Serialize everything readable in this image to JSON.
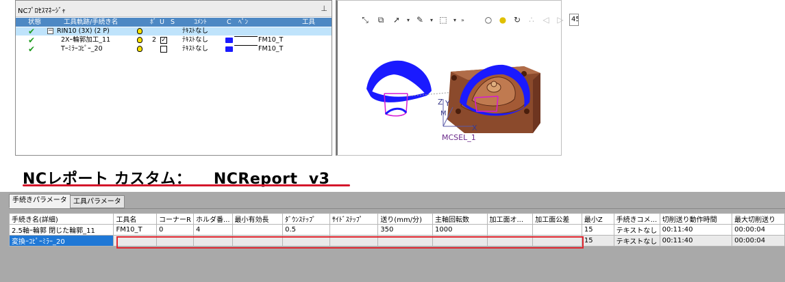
{
  "nc_process_manager": {
    "title": "NCﾌﾟﾛｾｽﾏﾈｰｼﾞｬ",
    "columns": [
      "状態",
      "工具軌跡/手続き名",
      "ﾎﾞ",
      "U",
      "S",
      "ｺﾒﾝﾄ",
      "C",
      "ﾍﾟﾝ",
      "工具"
    ],
    "rows": [
      {
        "name": "RIN10 (3X) (2 P)",
        "count": "",
        "checked": false,
        "has_checkbox": false,
        "comment": "ﾃｷｽﾄなし",
        "pen": false,
        "tool": ""
      },
      {
        "name": "2Xｰ輪郭加工_11",
        "count": "2",
        "checked": true,
        "has_checkbox": true,
        "comment": "ﾃｷｽﾄなし",
        "pen": true,
        "tool": "FM10_T"
      },
      {
        "name": "Tｰﾐﾗｰｺﾋﾟｰ_20",
        "count": "",
        "checked": false,
        "has_checkbox": true,
        "comment": "ﾃｷｽﾄなし",
        "pen": true,
        "tool": "FM10_T"
      }
    ],
    "tree_toggle": "−"
  },
  "view3d": {
    "zoom_value": "45",
    "axis_labels": {
      "z": "Z",
      "y": "Y",
      "x": "X",
      "m": "M"
    },
    "csys_label": "MCSEL_1",
    "toolbar_icons": [
      "select-x-icon",
      "box-select-icon",
      "cursor-icon",
      "pen-icon",
      "dotted-select-icon",
      "more-icon"
    ],
    "right_icons": [
      "bulb-outline-icon",
      "bulb-yellow-icon",
      "bulb-refresh-icon",
      "bulb-group-icon",
      "arrow-left-icon",
      "arrow-right-icon"
    ]
  },
  "heading": "NCレポート カスタム：    NCReport  v3",
  "colors": {
    "accent_red": "#d4142a",
    "selection_blue": "#1f78d6",
    "header_blue": "#4d88c4",
    "toolpath_blue": "#1a1aff",
    "magenta": "#d51ad5",
    "block_brown": "#8b4a2c"
  },
  "report": {
    "tabs": [
      "手続きパラメータ",
      "工具パラメータ"
    ],
    "columns": [
      "手続き名(詳細)",
      "工具名",
      "コーナーR",
      "ホルダ番...",
      "最小有効長",
      "ﾀﾞｳﾝｽﾃｯﾌﾟ",
      "ｻｲﾄﾞｽﾃｯﾌﾟ",
      "送り(mm/分)",
      "主軸回転数",
      "加工面オ...",
      "加工面公差",
      "最小Z",
      "手続きコメ...",
      "切削送り動作時間",
      "最大切削送り"
    ],
    "rows": [
      [
        "2.5軸ｰ輪郭 閉じた輪郭_11",
        "FM10_T",
        "0",
        "4",
        "",
        "0.5",
        "",
        "350",
        "1000",
        "",
        "",
        "15",
        "テキストなし",
        "00:11:40",
        "00:00:04"
      ],
      [
        "変換ｰｺﾋﾟｰﾐﾗｰ_20",
        "",
        "",
        "",
        "",
        "",
        "",
        "",
        "",
        "",
        "",
        "15",
        "テキストなし",
        "00:11:40",
        "00:00:04"
      ]
    ]
  }
}
